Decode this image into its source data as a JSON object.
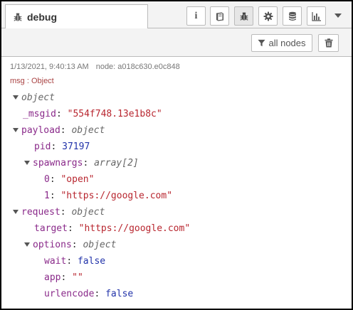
{
  "tab": {
    "label": "debug"
  },
  "tab_buttons": [
    {
      "name": "info-tab-button",
      "icon": "info-icon"
    },
    {
      "name": "help-tab-button",
      "icon": "book-icon"
    },
    {
      "name": "debug-tab-button",
      "icon": "bug-icon",
      "active": true
    },
    {
      "name": "config-tab-button",
      "icon": "gear-icon"
    },
    {
      "name": "context-tab-button",
      "icon": "database-icon"
    },
    {
      "name": "dashboard-tab-button",
      "icon": "bar-chart-icon"
    }
  ],
  "toolbar": {
    "filter_label": "all nodes"
  },
  "message": {
    "timestamp": "1/13/2021, 9:40:13 AM",
    "node": "node: a018c630.e0c848",
    "type_label": "msg : Object"
  },
  "tree": {
    "root_type": "object",
    "msgid_key": "_msgid",
    "msgid_value": "\"554f748.13e1b8c\"",
    "payload_key": "payload",
    "payload_type": "object",
    "pid_key": "pid",
    "pid_value": "37197",
    "spawnargs_key": "spawnargs",
    "spawnargs_type": "array[2]",
    "arg0_key": "0",
    "arg0_value": "\"open\"",
    "arg1_key": "1",
    "arg1_value": "\"https://google.com\"",
    "request_key": "request",
    "request_type": "object",
    "target_key": "target",
    "target_value": "\"https://google.com\"",
    "options_key": "options",
    "options_type": "object",
    "wait_key": "wait",
    "wait_value": "false",
    "app_key": "app",
    "app_value": "\"\"",
    "urlencode_key": "urlencode",
    "urlencode_value": "false"
  },
  "colors": {
    "key": "#8a2a8a",
    "string": "#b8262f",
    "number": "#2233aa",
    "type": "#666666",
    "msg_type": "#aa4444"
  }
}
